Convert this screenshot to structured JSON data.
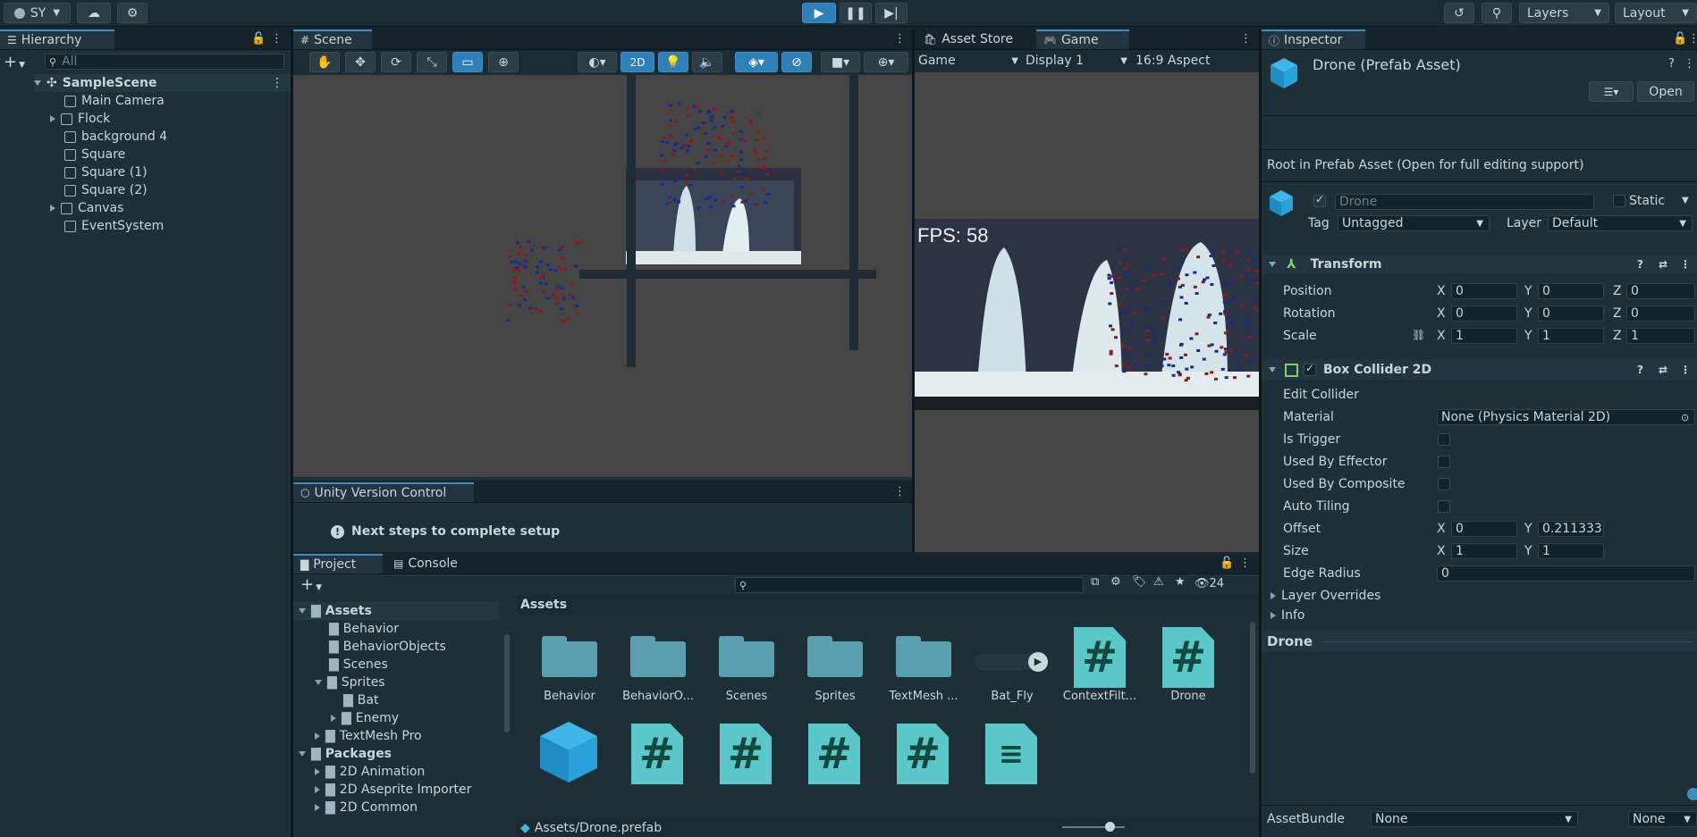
{
  "toolbar": {
    "account": "SY",
    "layers": "Layers",
    "layout": "Layout"
  },
  "hierarchy": {
    "tab": "Hierarchy",
    "search_placeholder": "All",
    "scene": "SampleScene",
    "items": [
      "Main Camera",
      "Flock",
      "background 4",
      "Square",
      "Square (1)",
      "Square (2)",
      "Canvas",
      "EventSystem"
    ]
  },
  "scene": {
    "tab": "Scene",
    "mode_2d": "2D"
  },
  "game": {
    "tab_store": "Asset Store",
    "tab_game": "Game",
    "dropdown_game": "Game",
    "display": "Display 1",
    "aspect": "16:9 Aspect",
    "fps": "FPS: 58"
  },
  "vcs": {
    "tab": "Unity Version Control",
    "message": "Next steps to complete setup"
  },
  "project": {
    "tab_project": "Project",
    "tab_console": "Console",
    "count": "24",
    "tree": [
      "Assets",
      "Behavior",
      "BehaviorObjects",
      "Scenes",
      "Sprites",
      "Bat",
      "Enemy",
      "TextMesh Pro",
      "Packages",
      "2D Animation",
      "2D Aseprite Importer",
      "2D Common"
    ],
    "breadcrumb": "Assets",
    "assets": [
      "Behavior",
      "BehaviorO...",
      "Scenes",
      "Sprites",
      "TextMesh ...",
      "Bat_Fly",
      "ContextFilt...",
      "Drone"
    ],
    "path": "Assets/Drone.prefab"
  },
  "inspector": {
    "tab": "Inspector",
    "title": "Drone (Prefab Asset)",
    "open": "Open",
    "root_msg": "Root in Prefab Asset (Open for full editing support)",
    "name": "Drone",
    "static": "Static",
    "tag_label": "Tag",
    "tag": "Untagged",
    "layer_label": "Layer",
    "layer": "Default",
    "transform": {
      "title": "Transform",
      "position": "Position",
      "rotation": "Rotation",
      "scale": "Scale",
      "pos": [
        "0",
        "0",
        "0"
      ],
      "rot": [
        "0",
        "0",
        "0"
      ],
      "scl": [
        "1",
        "1",
        "1"
      ]
    },
    "collider": {
      "title": "Box Collider 2D",
      "edit": "Edit Collider",
      "material": "Material",
      "material_value": "None (Physics Material 2D)",
      "is_trigger": "Is Trigger",
      "used_by_effector": "Used By Effector",
      "used_by_composite": "Used By Composite",
      "auto_tiling": "Auto Tiling",
      "offset": "Offset",
      "offset_x": "0",
      "offset_y": "0.211333",
      "size": "Size",
      "size_x": "1",
      "size_y": "1",
      "edge_radius": "Edge Radius",
      "edge_value": "0",
      "layer_overrides": "Layer Overrides",
      "info": "Info"
    },
    "preview": "Drone",
    "asset_bundle": "AssetBundle",
    "bundle_a": "None",
    "bundle_b": "None"
  },
  "axes": {
    "x": "X",
    "y": "Y",
    "z": "Z"
  }
}
